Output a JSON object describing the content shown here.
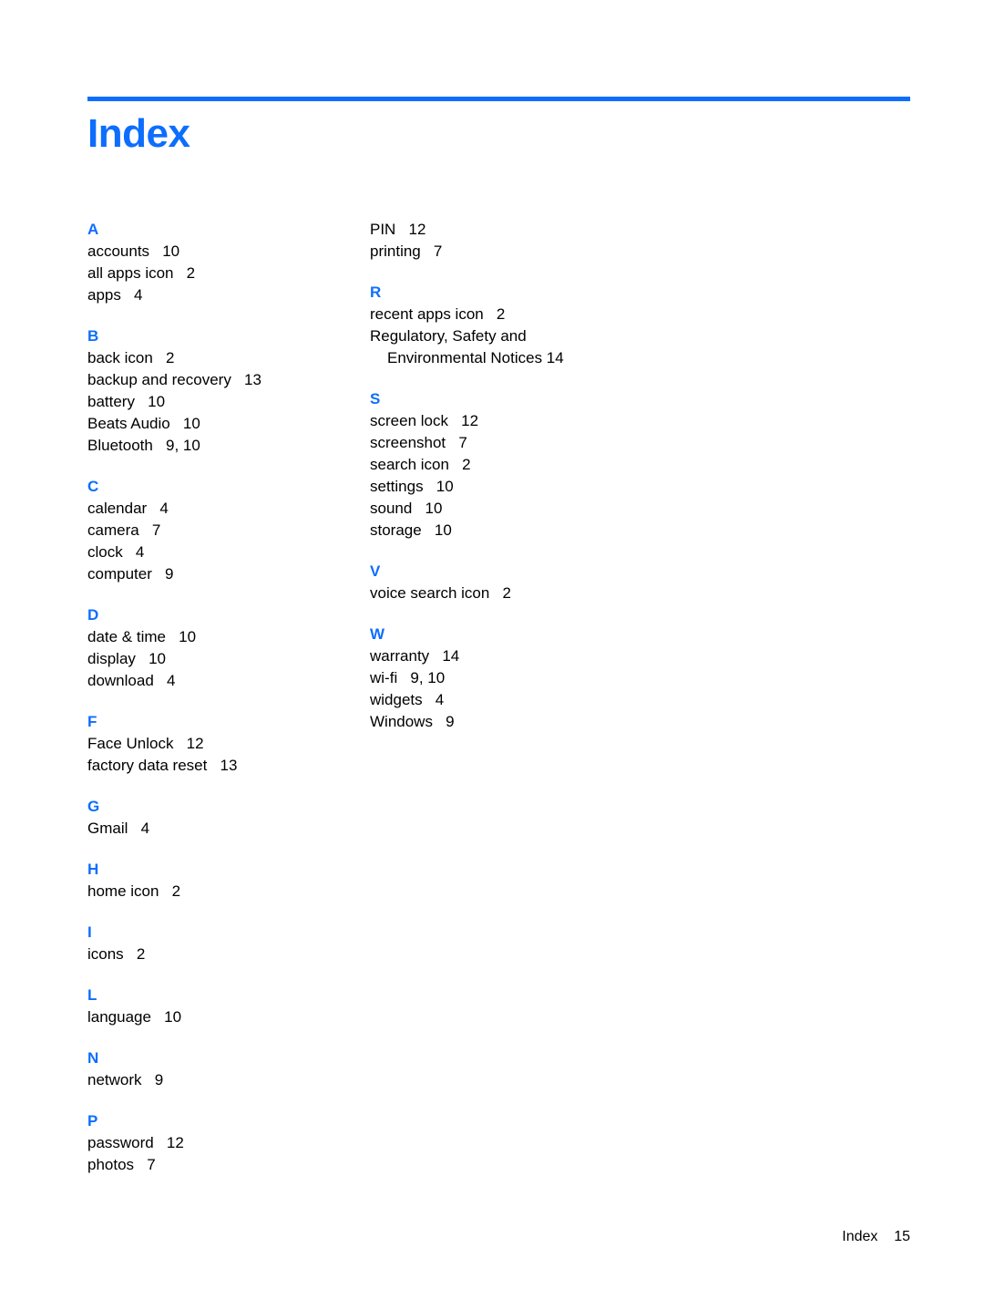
{
  "document": {
    "title": "Index",
    "accent_color": "#0d6efd",
    "text_color": "#000000",
    "background_color": "#ffffff"
  },
  "footer": {
    "label": "Index",
    "page_number": "15"
  },
  "columns": [
    {
      "id": "left",
      "groups": [
        {
          "letter": "A",
          "entries": [
            {
              "term": "accounts",
              "pages": "10"
            },
            {
              "term": "all apps icon",
              "pages": "2"
            },
            {
              "term": "apps",
              "pages": "4"
            }
          ]
        },
        {
          "letter": "B",
          "entries": [
            {
              "term": "back icon",
              "pages": "2"
            },
            {
              "term": "backup and recovery",
              "pages": "13"
            },
            {
              "term": "battery",
              "pages": "10"
            },
            {
              "term": "Beats Audio",
              "pages": "10"
            },
            {
              "term": "Bluetooth",
              "pages": "9, 10"
            }
          ]
        },
        {
          "letter": "C",
          "entries": [
            {
              "term": "calendar",
              "pages": "4"
            },
            {
              "term": "camera",
              "pages": "7"
            },
            {
              "term": "clock",
              "pages": "4"
            },
            {
              "term": "computer",
              "pages": "9"
            }
          ]
        },
        {
          "letter": "D",
          "entries": [
            {
              "term": "date & time",
              "pages": "10"
            },
            {
              "term": "display",
              "pages": "10"
            },
            {
              "term": "download",
              "pages": "4"
            }
          ]
        },
        {
          "letter": "F",
          "entries": [
            {
              "term": "Face Unlock",
              "pages": "12"
            },
            {
              "term": "factory data reset",
              "pages": "13"
            }
          ]
        },
        {
          "letter": "G",
          "entries": [
            {
              "term": "Gmail",
              "pages": "4"
            }
          ]
        },
        {
          "letter": "H",
          "entries": [
            {
              "term": "home icon",
              "pages": "2"
            }
          ]
        },
        {
          "letter": "I",
          "entries": [
            {
              "term": "icons",
              "pages": "2"
            }
          ]
        },
        {
          "letter": "L",
          "entries": [
            {
              "term": "language",
              "pages": "10"
            }
          ]
        },
        {
          "letter": "N",
          "entries": [
            {
              "term": "network",
              "pages": "9"
            }
          ]
        },
        {
          "letter": "P",
          "entries": [
            {
              "term": "password",
              "pages": "12"
            },
            {
              "term": "photos",
              "pages": "7"
            }
          ]
        }
      ]
    },
    {
      "id": "right",
      "groups": [
        {
          "letter": "",
          "entries": [
            {
              "term": "PIN",
              "pages": "12"
            },
            {
              "term": "printing",
              "pages": "7"
            }
          ]
        },
        {
          "letter": "R",
          "entries": [
            {
              "term": "recent apps icon",
              "pages": "2"
            },
            {
              "term": "Regulatory, Safety and",
              "pages": "",
              "continuation": "Environmental Notices",
              "continuation_pages": "14"
            }
          ]
        },
        {
          "letter": "S",
          "entries": [
            {
              "term": "screen lock",
              "pages": "12"
            },
            {
              "term": "screenshot",
              "pages": "7"
            },
            {
              "term": "search icon",
              "pages": "2"
            },
            {
              "term": "settings",
              "pages": "10"
            },
            {
              "term": "sound",
              "pages": "10"
            },
            {
              "term": "storage",
              "pages": "10"
            }
          ]
        },
        {
          "letter": "V",
          "entries": [
            {
              "term": "voice search icon",
              "pages": "2"
            }
          ]
        },
        {
          "letter": "W",
          "entries": [
            {
              "term": "warranty",
              "pages": "14"
            },
            {
              "term": "wi-fi",
              "pages": "9, 10"
            },
            {
              "term": "widgets",
              "pages": "4"
            },
            {
              "term": "Windows",
              "pages": "9"
            }
          ]
        }
      ]
    }
  ]
}
